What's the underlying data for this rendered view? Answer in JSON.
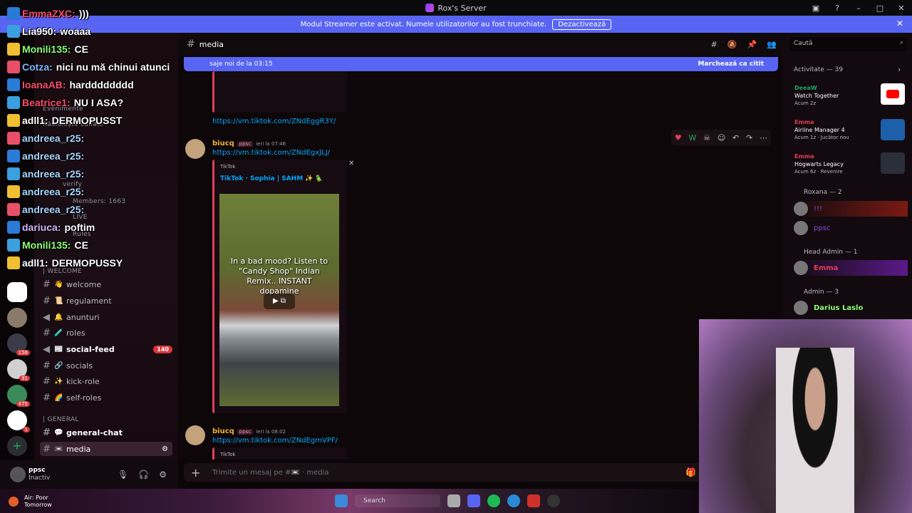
{
  "titlebar": {
    "title": "Rox's Server"
  },
  "banner": {
    "text": "Modul Streamer este activat. Numele utilizatorilor au fost trunchiate.",
    "button": "Dezactivează"
  },
  "servers": {
    "badges": [
      "156",
      "91",
      "475",
      "1"
    ]
  },
  "overlay_chat": [
    {
      "name": "EmmaZXC:",
      "msg": ")))",
      "color": "#ff4d6d"
    },
    {
      "name": "Lia950:",
      "msg": "woaaa",
      "color": "#ffffff"
    },
    {
      "name": "Monili135:",
      "msg": "CE",
      "color": "#8cff73"
    },
    {
      "name": "Cotza:",
      "msg": "nici nu mă chinui atunci",
      "color": "#7fb6ff"
    },
    {
      "name": "IoanaAB:",
      "msg": "hardddddddd",
      "color": "#ff4d6d"
    },
    {
      "name": "Beatrice1:",
      "msg": "NU I ASA?",
      "color": "#ff4d6d"
    },
    {
      "name": "adll1:",
      "msg": "DERMOPUSST",
      "color": "#ffffff"
    },
    {
      "name": "andreea_r25:",
      "msg": "",
      "color": "#a9d5ff"
    },
    {
      "name": "andreea_r25:",
      "msg": "",
      "color": "#a9d5ff"
    },
    {
      "name": "andreea_r25:",
      "msg": "",
      "color": "#a9d5ff"
    },
    {
      "name": "andreea_r25:",
      "msg": "",
      "color": "#a9d5ff"
    },
    {
      "name": "andreea_r25:",
      "msg": "",
      "color": "#a9d5ff"
    },
    {
      "name": "dariuca:",
      "msg": "poftim",
      "color": "#d3b5ff"
    },
    {
      "name": "Monili135:",
      "msg": "CE",
      "color": "#8cff73"
    },
    {
      "name": "adll1:",
      "msg": "DERMOPUSSY",
      "color": "#ffffff"
    }
  ],
  "channel_sidebar": {
    "events": "Evenimente",
    "browse": "Răsfoiește canale",
    "welcome_cat": "| WELCOME",
    "verify": "verify",
    "members": "Members: 1663",
    "live": "LIVE",
    "rules": "Rules",
    "general_cat": "| GENERAL",
    "channels": [
      {
        "emoji": "👋",
        "label": "welcome",
        "count": ""
      },
      {
        "emoji": "📜",
        "label": "regulament",
        "count": ""
      },
      {
        "emoji": "🔔",
        "label": "anunturi",
        "count": ""
      },
      {
        "emoji": "🧪",
        "label": "roles",
        "count": ""
      },
      {
        "emoji": "📰",
        "label": "social-feed",
        "count": "140"
      },
      {
        "emoji": "🔗",
        "label": "socials",
        "count": ""
      },
      {
        "emoji": "✨",
        "label": "kick-role",
        "count": ""
      },
      {
        "emoji": "🌈",
        "label": "self-roles",
        "count": ""
      },
      {
        "emoji": "💬",
        "label": "general-chat",
        "count": ""
      },
      {
        "emoji": "📼",
        "label": "media",
        "count": ""
      }
    ]
  },
  "user": {
    "name": "ppsc",
    "status": "Inactiv"
  },
  "channel_header": {
    "name": "media"
  },
  "new_messages": {
    "text": "saje noi de la 03:15",
    "mark": "Marchează ca citit"
  },
  "messages": [
    {
      "author": "biucq",
      "tag": "ppsc",
      "time": "ieri la 07:46",
      "link": "https://vm.tiktok.com/ZNdEgxJLJ/",
      "embed": {
        "provider": "TikTok",
        "title": "TikTok · Sophia | SAHM ✨ 🦜",
        "caption": "In a bad mood? Listen to \"Candy Shop\" Indian Remix.. INSTANT dopamine"
      }
    },
    {
      "author": "biucq",
      "tag": "ppsc",
      "time": "ieri la 08:02",
      "link": "https://vm.tiktok.com/ZNdEgmVPF/",
      "embed": {
        "provider": "TikTok"
      }
    }
  ],
  "prev_link": "https://vm.tiktok.com/ZNdEggR3Y/",
  "composer": {
    "placeholder": "Trimite un mesaj pe #📼 · media"
  },
  "members_panel": {
    "search": "Caută",
    "activity_title": "Activitate — 39",
    "activities": [
      {
        "name": "DeeaW",
        "game": "Watch Together",
        "detail": "Acum 2z"
      },
      {
        "name": "Emma",
        "game": "Airline Manager 4",
        "detail": "Acum 1z · Jucător nou"
      },
      {
        "name": "Emma",
        "game": "Hogwarts Legacy",
        "detail": "Acum 6z · Revenire"
      }
    ],
    "roxana_section": "Roxana — 2",
    "roxana_members": [
      "!!!",
      "ppsc"
    ],
    "head_admin_section": "Head Admin — 1",
    "head_admin_member": "Emma",
    "admin_section": "Admin — 3",
    "admin_member": "Darius Laslo"
  },
  "taskbar": {
    "weather_line1": "Air: Poor",
    "weather_line2": "Tomorrow",
    "search": "Search"
  }
}
